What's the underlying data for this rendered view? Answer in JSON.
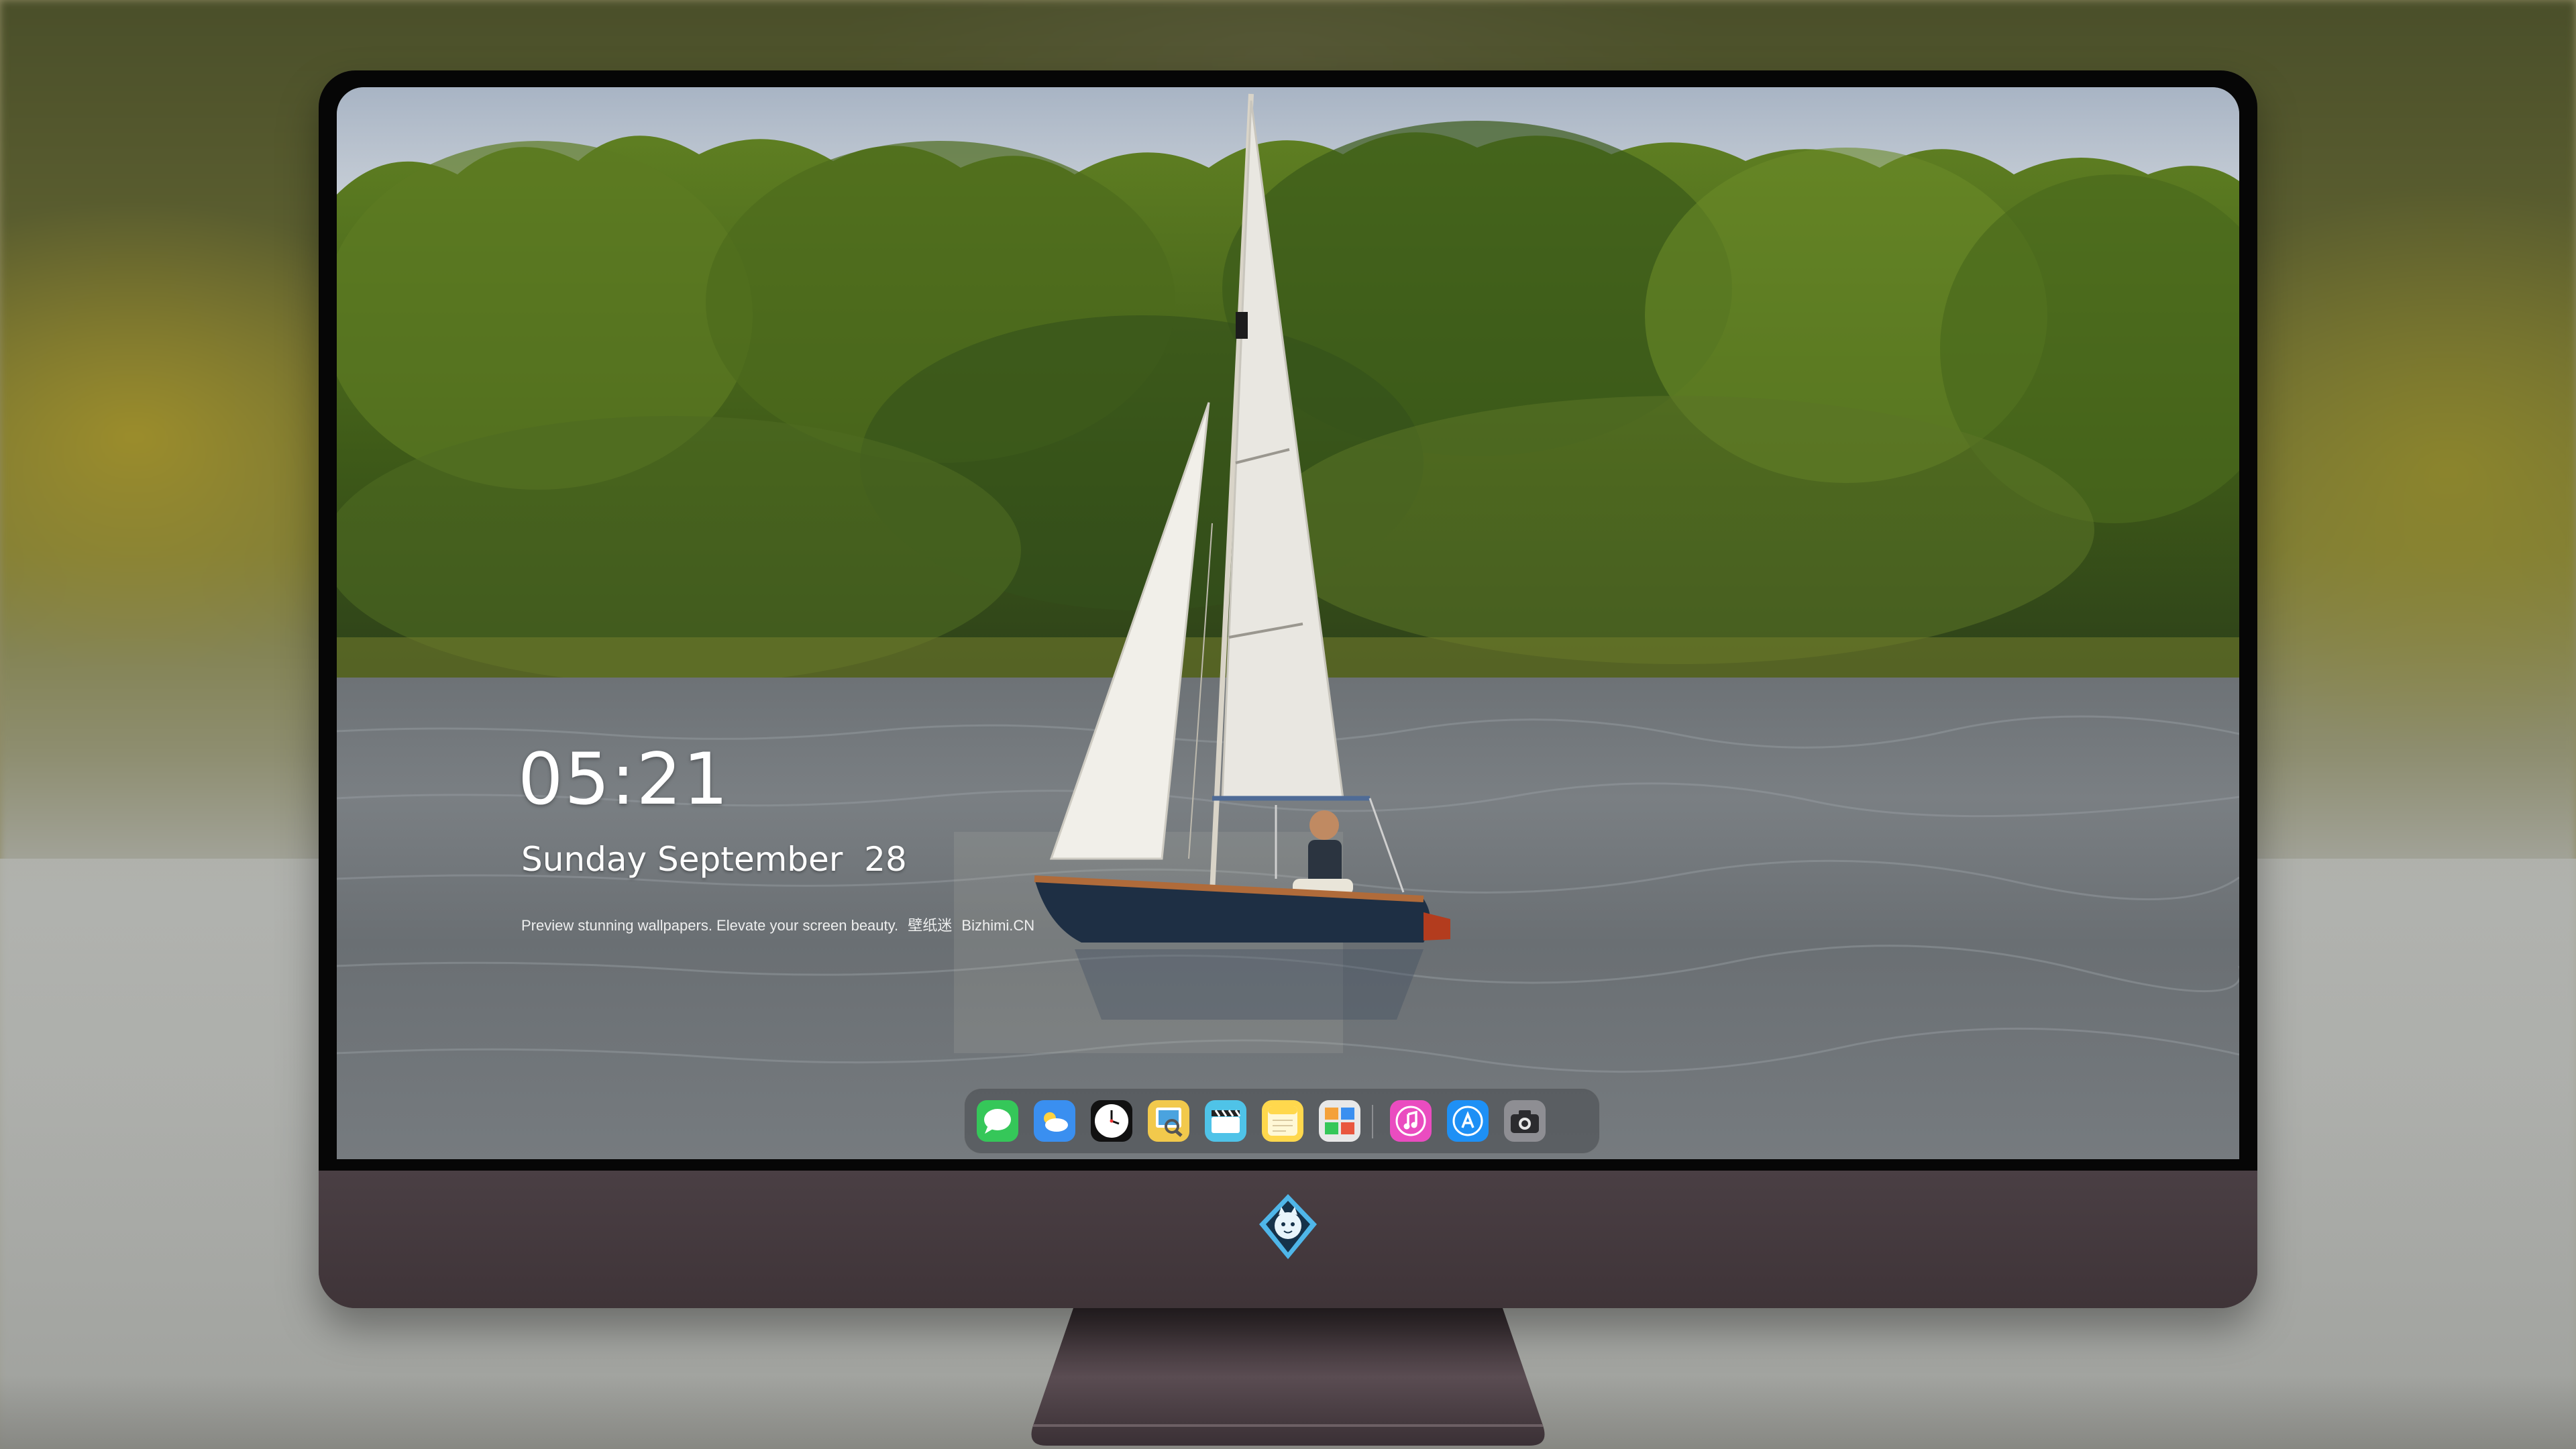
{
  "lockscreen": {
    "time": "05:21",
    "date": "Sunday September  28",
    "tagline_text": "Preview stunning wallpapers. Elevate your screen beauty.",
    "tagline_cn": "壁纸迷",
    "tagline_site": "Bizhimi.CN"
  },
  "dock": {
    "apps": [
      {
        "name": "Messages",
        "icon": "messages-icon",
        "color": "#35c759"
      },
      {
        "name": "Weather",
        "icon": "weather-icon",
        "color": "#3a8ff0"
      },
      {
        "name": "Clock",
        "icon": "clock-icon",
        "color": "#111111"
      },
      {
        "name": "Preview",
        "icon": "preview-icon",
        "color": "#f2c94c"
      },
      {
        "name": "Clips",
        "icon": "clapperboard-icon",
        "color": "#4fc3e8"
      },
      {
        "name": "Notes",
        "icon": "notes-icon",
        "color": "#ffd84d"
      },
      {
        "name": "Photo Gallery",
        "icon": "gallery-icon",
        "color": "#e8e8e8"
      },
      {
        "name": "iTunes",
        "icon": "music-icon",
        "color": "#ea4cc0"
      },
      {
        "name": "App Store",
        "icon": "app-store-icon",
        "color": "#1e90f5"
      },
      {
        "name": "Camera",
        "icon": "camera-icon",
        "color": "#8e8e93"
      }
    ]
  },
  "colors": {
    "monitor_body": "#45393e",
    "bezel": "#060606",
    "dock_background": "rgba(70,72,76,0.55)"
  }
}
